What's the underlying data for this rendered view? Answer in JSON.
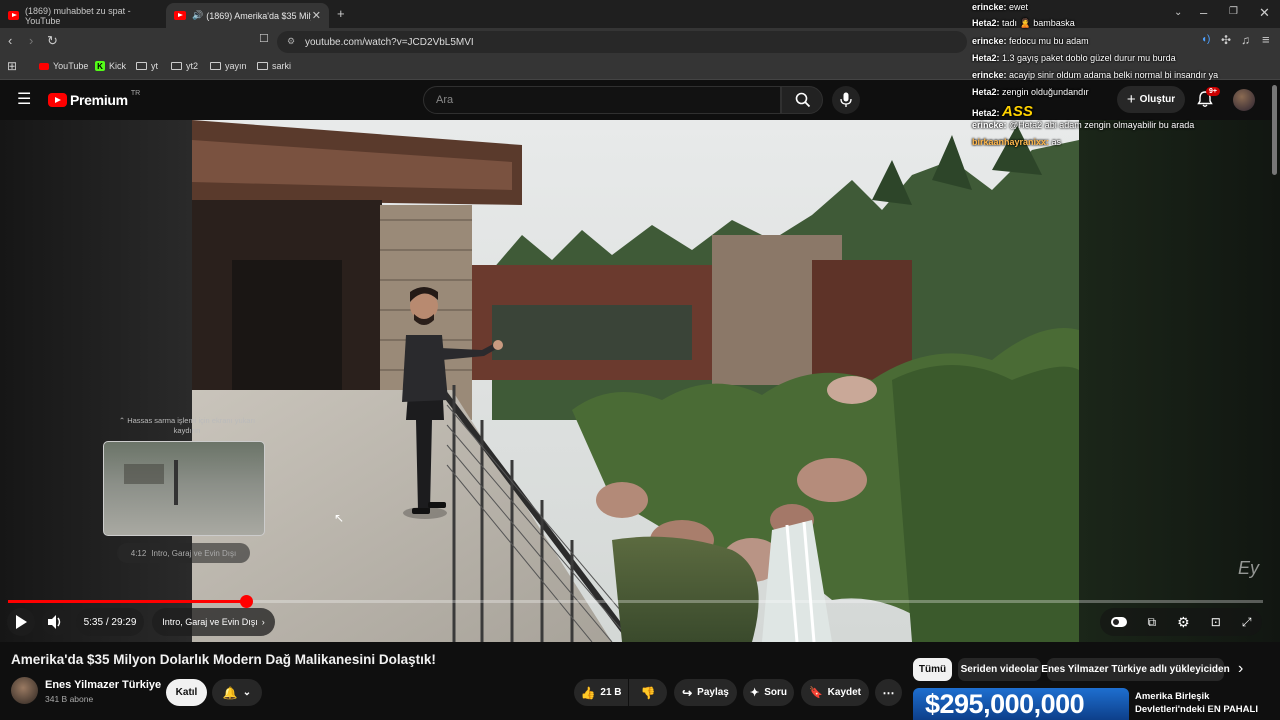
{
  "browser": {
    "tabs": [
      {
        "label": "(1869) muhabbet zu spat - YouTube"
      },
      {
        "label": "(1869) Amerika'da $35 Milyon"
      }
    ],
    "url": "youtube.com/watch?v=JCD2VbL5MVI",
    "bookmarks": [
      "YouTube",
      "Kick",
      "yt",
      "yt2",
      "yayın",
      "sarki"
    ]
  },
  "header": {
    "logo": "Premium",
    "region": "TR",
    "search_placeholder": "Ara",
    "create_label": "Oluştur",
    "notification_badge": "9+"
  },
  "chat": [
    {
      "user": "erincke",
      "msg": "ewet",
      "color": "#ffffff"
    },
    {
      "user": "Heta2",
      "msg": "tadı 🙎 bambaska",
      "color": "#ffffff"
    },
    {
      "user": "erincke",
      "msg": "fedocu mu bu adam",
      "color": "#ffffff"
    },
    {
      "user": "Heta2",
      "msg": "1.3 gayış paket doblo güzel durur mu burda",
      "color": "#ffffff"
    },
    {
      "user": "erincke",
      "msg": "acayip sinir oldum adama belki normal bi insandır ya",
      "color": "#ffffff"
    },
    {
      "user": "Heta2",
      "msg": "zengin olduğundandır",
      "color": "#ffffff"
    },
    {
      "user": "Heta2",
      "msg": "ASS",
      "color": "#ffd200"
    },
    {
      "user": "erincke",
      "msg": "@Heta2 abi adam zengin olmayabilir bu arada",
      "color": "#ffffff"
    },
    {
      "user": "birkaanhayranixx",
      "msg": "as",
      "color": "#ffffff"
    }
  ],
  "player": {
    "seek_hint": "Hassas sarma işlemi için ekranı yukarı kaydırın",
    "preview_time": "4:12",
    "preview_chapter": "Intro, Garaj ve Evin Dışı",
    "time": "5:35 / 29:29",
    "chapter": "Intro, Garaj ve Evin Dışı",
    "progress": 0.19,
    "watermark": "Ey"
  },
  "video": {
    "title": "Amerika'da $35 Milyon Dolarlık Modern Dağ Malikanesini Dolaştık!",
    "channel": "Enes Yilmazer Türkiye",
    "subscribers": "341 B abone",
    "join_label": "Katıl",
    "likes": "21 B",
    "share_label": "Paylaş",
    "ask_label": "Soru",
    "save_label": "Kaydet"
  },
  "sidebar": {
    "chips": [
      "Tümü",
      "Seriden videolar",
      "Enes Yilmazer Türkiye adlı yükleyiciden"
    ],
    "next_thumb_text": "$295,000,000",
    "next_title": "Amerika Birleşik Devletleri'ndeki EN PAHALI"
  },
  "colors": {
    "accent": "#ff0000",
    "bg": "#0f0f0f"
  }
}
